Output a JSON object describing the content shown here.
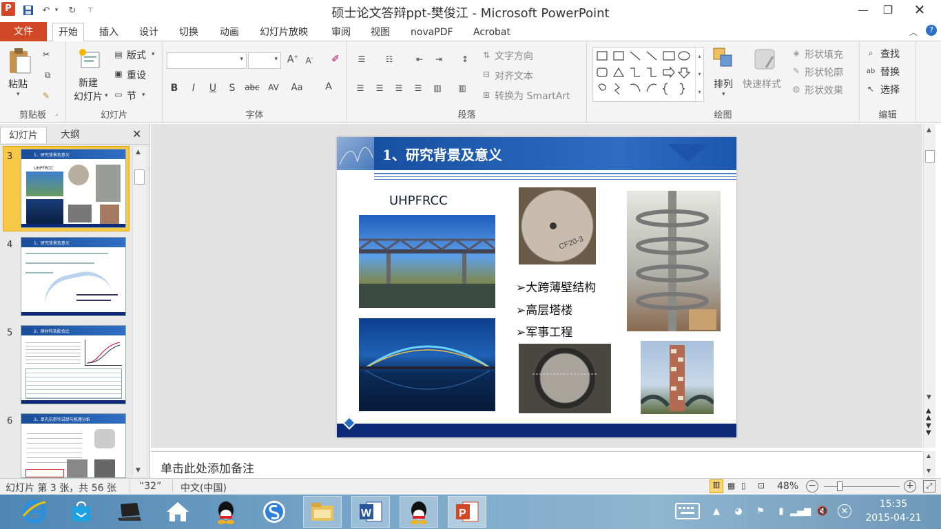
{
  "window": {
    "title": "硕士论文答辩ppt-樊俊江 - Microsoft PowerPoint",
    "app_icon_letter": "P",
    "controls": [
      "minimize-icon",
      "restore-icon",
      "close-icon"
    ]
  },
  "quick_access": [
    "save-icon",
    "undo-icon",
    "redo-icon",
    "customize-icon"
  ],
  "tabs": [
    "文件",
    "开始",
    "插入",
    "设计",
    "切换",
    "动画",
    "幻灯片放映",
    "审阅",
    "视图",
    "novaPDF",
    "Acrobat"
  ],
  "active_tab": "开始",
  "ribbon": {
    "clipboard": {
      "paste": "粘贴",
      "label": "剪贴板"
    },
    "slides": {
      "new_slide_line1": "新建",
      "new_slide_line2": "幻灯片",
      "layout": "版式",
      "reset": "重设",
      "section": "节",
      "label": "幻灯片"
    },
    "font": {
      "font_name": "",
      "font_size": "",
      "bold": "B",
      "italic": "I",
      "underline": "U",
      "shadow": "S",
      "strike": "abc",
      "spacing": "AV",
      "case": "Aa",
      "color": "A",
      "label": "字体"
    },
    "paragraph": {
      "text_direction": "文字方向",
      "align_text": "对齐文本",
      "smartart": "转换为 SmartArt",
      "label": "段落"
    },
    "drawing": {
      "arrange": "排列",
      "quick_styles": "快速样式",
      "shape_fill": "形状填充",
      "shape_outline": "形状轮廓",
      "shape_effects": "形状效果",
      "label": "绘图"
    },
    "editing": {
      "find": "查找",
      "replace": "替换",
      "select": "选择",
      "label": "编辑"
    }
  },
  "left_panel": {
    "tabs": [
      "幻灯片",
      "大纲"
    ],
    "active_tab": "幻灯片",
    "slides": [
      {
        "number": "3",
        "title": "1、研究背景及意义",
        "selected": true
      },
      {
        "number": "4",
        "title": "1、研究背景及意义",
        "selected": false
      },
      {
        "number": "5",
        "title": "2、原材料及配合比",
        "selected": false
      },
      {
        "number": "6",
        "title": "3、单孔抗剪切试验与机理分析",
        "selected": false
      }
    ]
  },
  "slide": {
    "title": "1、研究背景及意义",
    "label": "UHPFRCC",
    "bullets": [
      "大跨薄壁结构",
      "高层塔楼",
      "军事工程"
    ],
    "images": [
      "truss-bridge-photo",
      "night-arch-bridge-photo",
      "concrete-specimen-photo",
      "spiral-staircase-photo",
      "manhole-cover-photo",
      "tower-photo"
    ]
  },
  "notes": {
    "placeholder": "单击此处添加备注"
  },
  "status": {
    "slide_info": "幻灯片 第 3 张，共 56 张",
    "theme": "“32”",
    "language": "中文(中国)",
    "zoom": "48%",
    "zoom_fraction": 0.48
  },
  "taskbar": {
    "apps": [
      "ie-icon",
      "store-icon",
      "laptop-icon",
      "home-icon",
      "qq-icon",
      "sogou-icon",
      "explorer-icon",
      "word-icon",
      "qq-icon",
      "powerpoint-icon"
    ],
    "time": "15:35",
    "date": "2015-04-21"
  },
  "colors": {
    "file_tab": "#d24726",
    "slide_header": "#1f5cb0",
    "slide_footer": "#0d2a78",
    "selected_thumb": "#f7c846"
  }
}
